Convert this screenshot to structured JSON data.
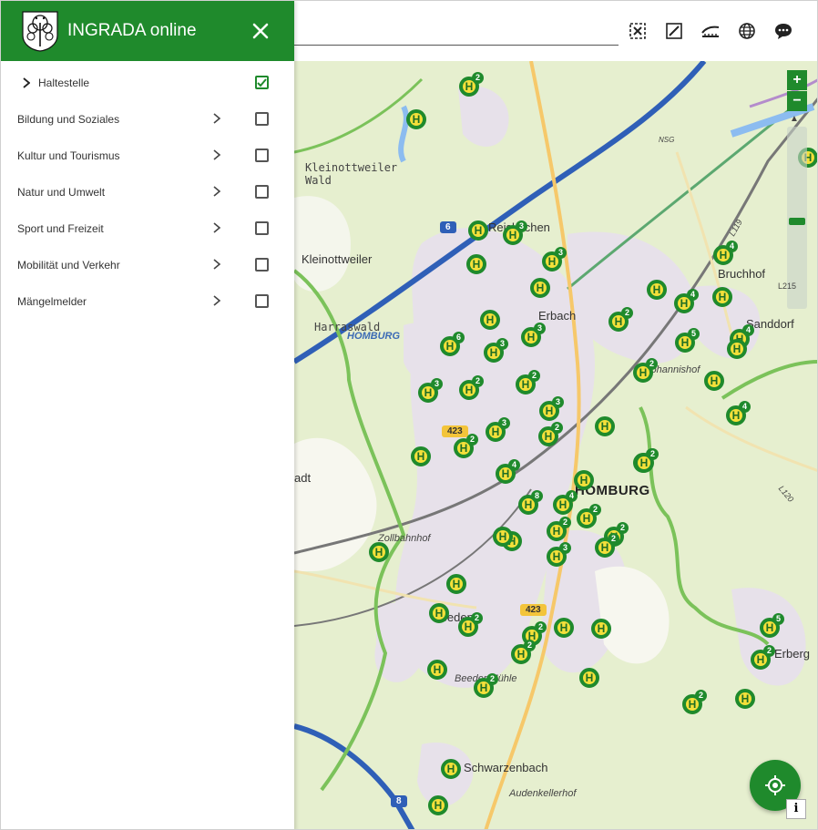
{
  "app": {
    "title": "INGRADA online",
    "brand_color": "#1f8a2c"
  },
  "panel": {
    "items": [
      {
        "label": "Haltestelle",
        "checked": true,
        "expanded_marker": true
      },
      {
        "label": "Bildung und Soziales",
        "checked": false
      },
      {
        "label": "Kultur und Tourismus",
        "checked": false
      },
      {
        "label": "Natur und Umwelt",
        "checked": false
      },
      {
        "label": "Sport und Freizeit",
        "checked": false
      },
      {
        "label": "Mobilität und Verkehr",
        "checked": false
      },
      {
        "label": "Mängelmelder",
        "checked": false
      }
    ]
  },
  "toolbar": {
    "icons": [
      "clear-selection-icon",
      "measure-line-icon",
      "measure-area-icon",
      "globe-icon",
      "comment-icon"
    ]
  },
  "map": {
    "zoom_in": "+",
    "zoom_out": "−",
    "scale_label": "L215",
    "north": "N",
    "info": "i",
    "places": [
      {
        "name": "Kleinottweiler\nWald"
      },
      {
        "name": "Kleinottweiler"
      },
      {
        "name": "Reiskirchen"
      },
      {
        "name": "Erbach"
      },
      {
        "name": "Bruchhof"
      },
      {
        "name": "Sanddorf"
      },
      {
        "name": "Johannishof"
      },
      {
        "name": "Harraswald"
      },
      {
        "name": "HOMBURG"
      },
      {
        "name": "HOMBURG"
      },
      {
        "name": "Zollbahnhof"
      },
      {
        "name": "Beeden"
      },
      {
        "name": "Beeder Mühle"
      },
      {
        "name": "Schwarzenbach"
      },
      {
        "name": "Audenkellerhof"
      },
      {
        "name": "Erberg"
      },
      {
        "name": "adt"
      },
      {
        "name": "NSG"
      },
      {
        "name": "L119"
      },
      {
        "name": "L120"
      }
    ],
    "road_badges": [
      "6",
      "423",
      "423",
      "8"
    ],
    "stops": [
      {
        "count": "2"
      },
      {
        "count": ""
      },
      {
        "count": ""
      },
      {
        "count": ""
      },
      {
        "count": "3"
      },
      {
        "count": ""
      },
      {
        "count": "3"
      },
      {
        "count": ""
      },
      {
        "count": ""
      },
      {
        "count": "4"
      },
      {
        "count": ""
      },
      {
        "count": "4"
      },
      {
        "count": ""
      },
      {
        "count": "3"
      },
      {
        "count": "6"
      },
      {
        "count": "3"
      },
      {
        "count": "2"
      },
      {
        "count": "5"
      },
      {
        "count": "4"
      },
      {
        "count": ""
      },
      {
        "count": ""
      },
      {
        "count": "2"
      },
      {
        "count": "4"
      },
      {
        "count": "2"
      },
      {
        "count": "3"
      },
      {
        "count": "2"
      },
      {
        "count": "3"
      },
      {
        "count": ""
      },
      {
        "count": "3"
      },
      {
        "count": "2"
      },
      {
        "count": ""
      },
      {
        "count": "2"
      },
      {
        "count": "4"
      },
      {
        "count": "5"
      },
      {
        "count": ""
      },
      {
        "count": "2"
      },
      {
        "count": "4"
      },
      {
        "count": "8"
      },
      {
        "count": "2"
      },
      {
        "count": "3"
      },
      {
        "count": "2"
      },
      {
        "count": ""
      },
      {
        "count": "2"
      },
      {
        "count": ""
      },
      {
        "count": ""
      },
      {
        "count": "2"
      },
      {
        "count": ""
      },
      {
        "count": "2"
      },
      {
        "count": ""
      },
      {
        "count": "2"
      },
      {
        "count": ""
      },
      {
        "count": ""
      },
      {
        "count": ""
      },
      {
        "count": "2"
      },
      {
        "count": "2"
      },
      {
        "count": "5"
      },
      {
        "count": "2"
      },
      {
        "count": "2"
      },
      {
        "count": ""
      },
      {
        "count": ""
      },
      {
        "count": ""
      },
      {
        "count": ""
      }
    ]
  }
}
